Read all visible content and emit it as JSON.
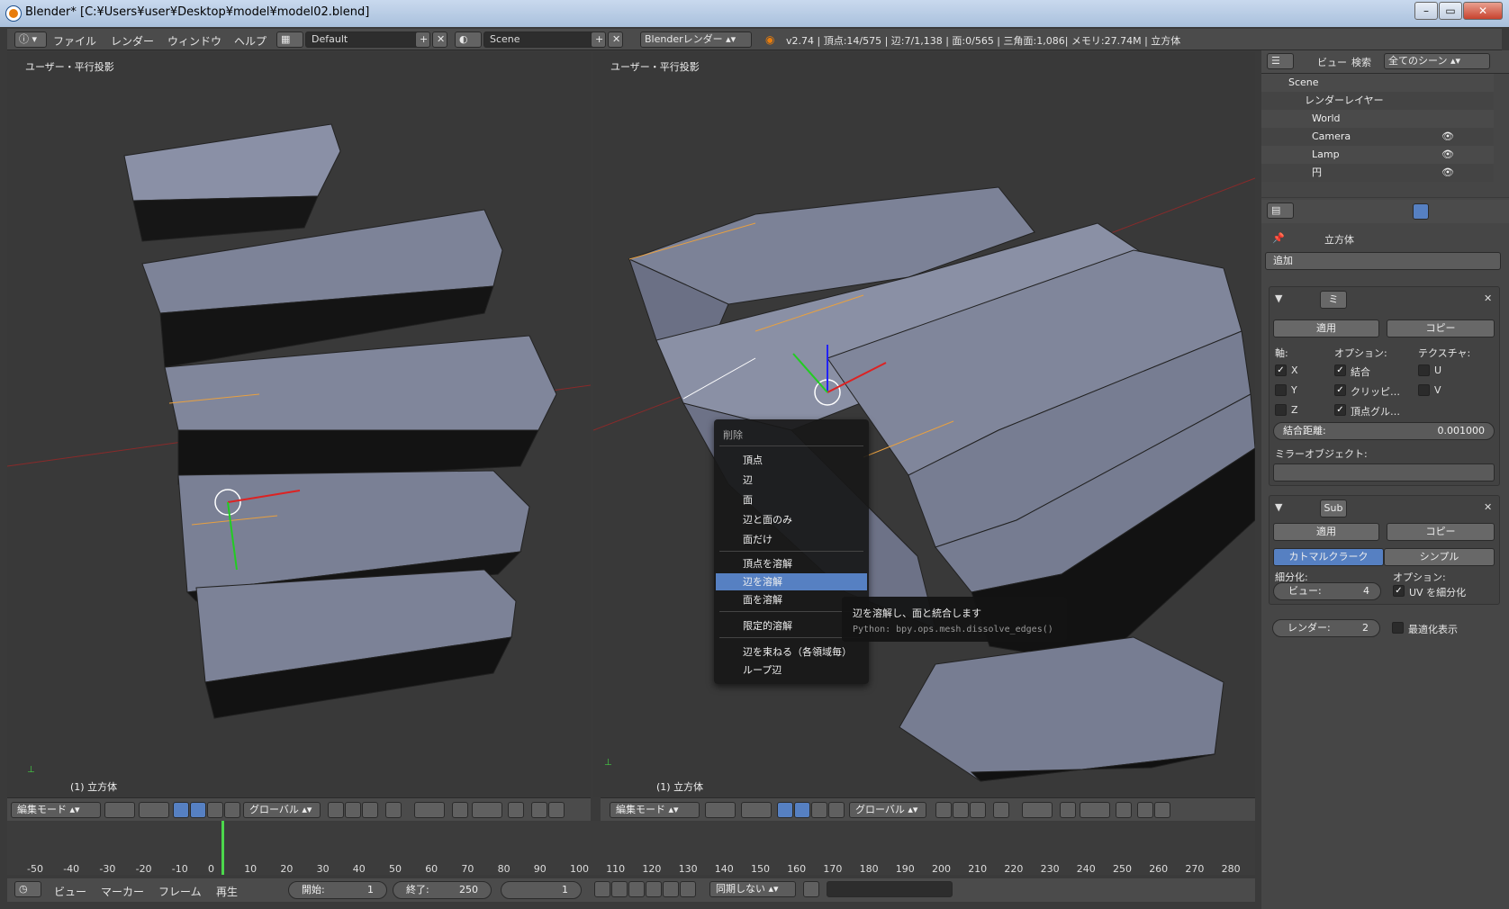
{
  "window": {
    "title": "Blender* [C:¥Users¥user¥Desktop¥model¥model02.blend]",
    "min": "–",
    "max": "▭",
    "close": "✕"
  },
  "menu": {
    "items": [
      "ファイル",
      "レンダー",
      "ウィンドウ",
      "ヘルプ"
    ]
  },
  "screen_layout": "Default",
  "scene": "Scene",
  "render_engine": "Blenderレンダー",
  "stats": "v2.74 | 頂点:14/575 | 辺:7/1,138 | 面:0/565 | 三角面:1,086| メモリ:27.74M | 立方体",
  "viewport_left": {
    "label": "ユーザー・平行投影",
    "object": "(1) 立方体",
    "mode": "編集モード",
    "orientation": "グローバル"
  },
  "viewport_right": {
    "label": "ユーザー・平行投影",
    "object": "(1) 立方体",
    "mode": "編集モード",
    "orientation": "グローバル"
  },
  "delete_menu": {
    "title": "削除",
    "items": [
      "頂点",
      "辺",
      "面",
      "辺と面のみ",
      "面だけ",
      "頂点を溶解",
      "辺を溶解",
      "面を溶解",
      "限定的溶解",
      "辺を束ねる（各領域毎）",
      "ループ辺"
    ],
    "highlighted": "辺を溶解"
  },
  "tooltip": {
    "text": "辺を溶解し、面と統合します",
    "python": "Python: bpy.ops.mesh.dissolve_edges()"
  },
  "outliner": {
    "view": "ビュー",
    "search": "検索",
    "filter": "全てのシーン",
    "rows": [
      "Scene",
      "レンダーレイヤー",
      "World",
      "Camera",
      "Lamp",
      "円"
    ]
  },
  "properties": {
    "object": "立方体",
    "add_modifier": "追加",
    "mirror": {
      "name": "ミ",
      "apply": "適用",
      "copy": "コピー",
      "axis_label": "軸:",
      "options_label": "オプション:",
      "texture_label": "テクスチャ:",
      "x": "X",
      "y": "Y",
      "z": "Z",
      "merge": "結合",
      "clipping": "クリッピ…",
      "vgroups": "頂点グル…",
      "u": "U",
      "v": "V",
      "merge_limit_label": "結合距離:",
      "merge_limit": "0.001000",
      "mirror_object_label": "ミラーオブジェクト:"
    },
    "subsurf": {
      "name": "Sub",
      "apply": "適用",
      "copy": "コピー",
      "catmull": "カトマルクラーク",
      "simple": "シンプル",
      "subdiv_label": "細分化:",
      "options_label": "オプション:",
      "view_label": "ビュー:",
      "view_val": "4",
      "render_label": "レンダー:",
      "render_val": "2",
      "subdivide_uv": "UV を細分化",
      "optimal_display": "最適化表示"
    }
  },
  "timeline": {
    "ticks": [
      "-50",
      "-40",
      "-30",
      "-20",
      "-10",
      "0",
      "10",
      "20",
      "30",
      "40",
      "50",
      "60",
      "70",
      "80",
      "90",
      "100",
      "110",
      "120",
      "130",
      "140",
      "150",
      "160",
      "170",
      "180",
      "190",
      "200",
      "210",
      "220",
      "230",
      "240",
      "250",
      "260",
      "270",
      "280"
    ],
    "view": "ビュー",
    "marker": "マーカー",
    "frame": "フレーム",
    "playback": "再生",
    "start_label": "開始:",
    "start": "1",
    "end_label": "終了:",
    "end": "250",
    "current": "1",
    "sync": "同期しない"
  }
}
